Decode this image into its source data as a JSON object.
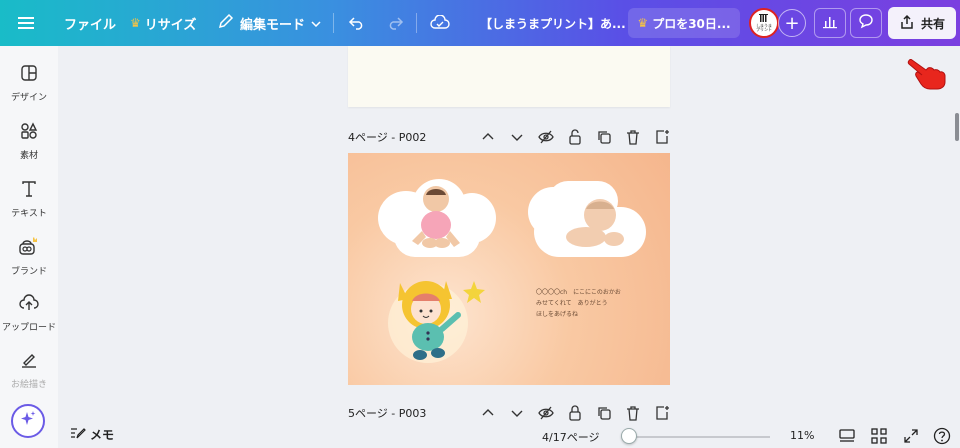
{
  "topbar": {
    "menu_icon": "hamburger-icon",
    "file_label": "ファイル",
    "resize_label": "リサイズ",
    "edit_mode_label": "編集モード",
    "doc_title": "【しまうまプリント】あ...",
    "pro_label": "プロを30日...",
    "avatar_text_1": "しまうま",
    "avatar_text_2": "プリント",
    "share_label": "共有"
  },
  "sidebar": {
    "items": [
      {
        "label": "デザイン",
        "icon": "design-layout-icon"
      },
      {
        "label": "素材",
        "icon": "elements-icon"
      },
      {
        "label": "テキスト",
        "icon": "text-icon"
      },
      {
        "label": "ブランド",
        "icon": "brand-icon"
      },
      {
        "label": "アップロード",
        "icon": "upload-cloud-icon"
      },
      {
        "label": "お絵描き",
        "icon": "draw-icon"
      }
    ]
  },
  "pages": {
    "page4_title": "4ページ - P002",
    "page5_title": "5ページ - P003",
    "page4_text_1": "〇〇〇〇ch　にこにこのおかお",
    "page4_text_2": "みせてくれて　ありがとう",
    "page4_text_3": "ほしをあげるね"
  },
  "bottombar": {
    "memo_label": "メモ",
    "page_indicator": "4/17ページ",
    "zoom_label": "11%",
    "zoom_fraction": 0.05
  },
  "colors": {
    "accent": "#7b3fe0",
    "teal": "#19bcc8",
    "crown": "#f6c445"
  }
}
